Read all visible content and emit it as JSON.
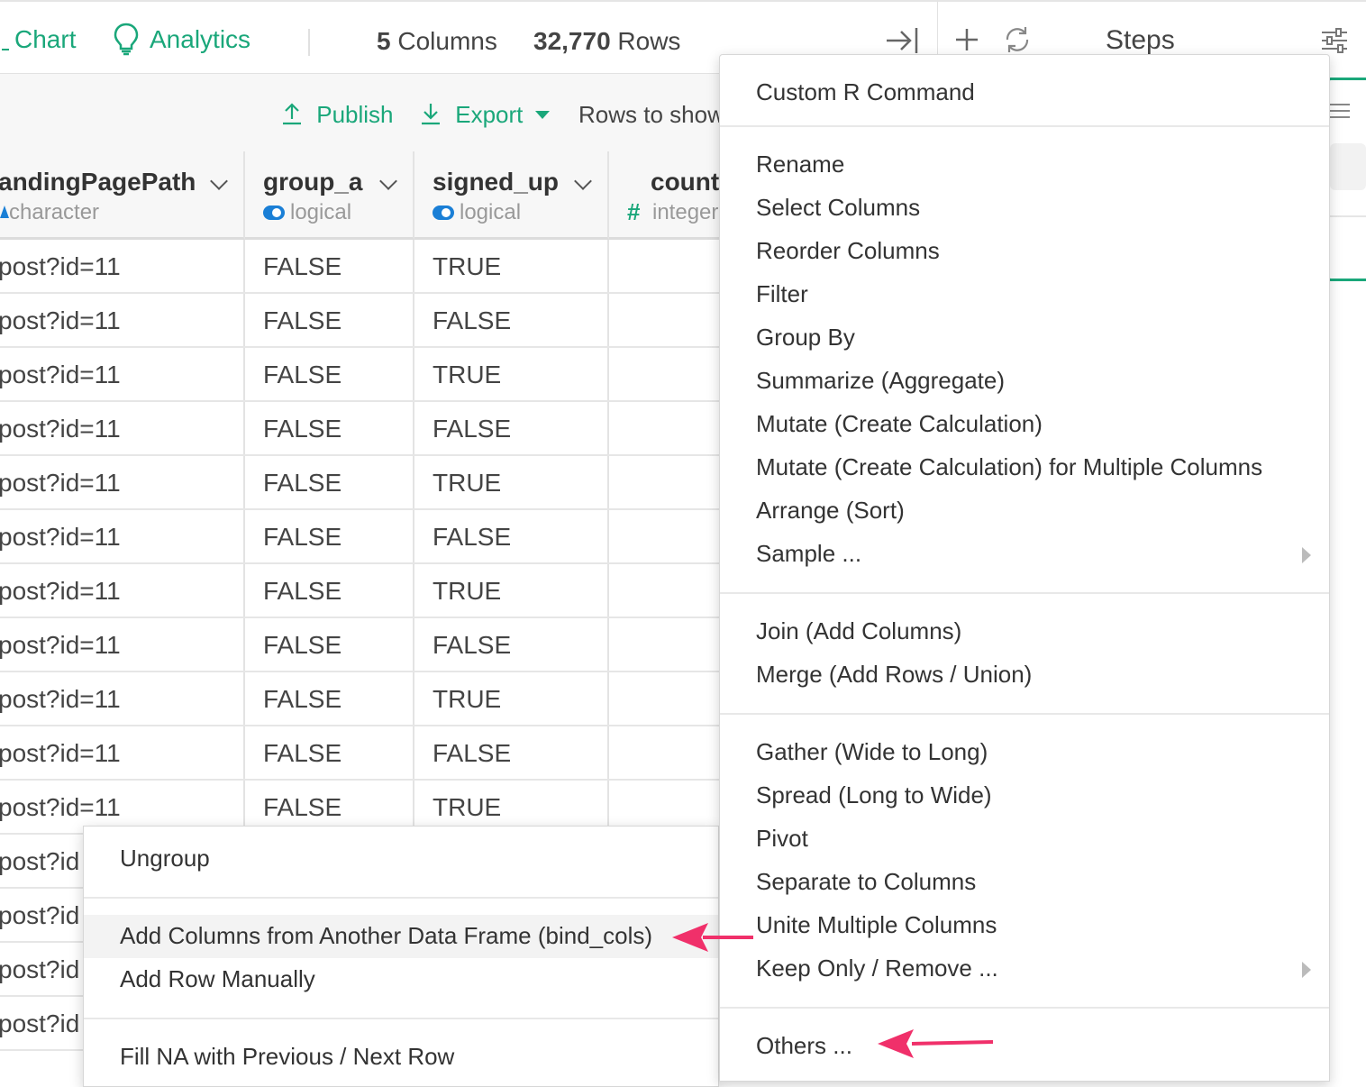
{
  "topbar": {
    "chart_label": "Chart",
    "analytics_label": "Analytics",
    "columns_count": "5",
    "columns_label": "Columns",
    "rows_count": "32,770",
    "rows_label": "Rows"
  },
  "steps_panel": {
    "title": "Steps"
  },
  "toolbar": {
    "publish_label": "Publish",
    "export_label": "Export",
    "rows_to_show_label": "Rows to show"
  },
  "table": {
    "columns": [
      {
        "name": "andingPagePath",
        "type": "character",
        "type_icon": "character-icon"
      },
      {
        "name": "group_a",
        "type": "logical",
        "type_icon": "toggle-icon"
      },
      {
        "name": "signed_up",
        "type": "logical",
        "type_icon": "toggle-icon"
      },
      {
        "name": "count",
        "type": "integer",
        "type_icon": "hash-icon"
      }
    ],
    "rows": [
      [
        "post?id=11",
        "FALSE",
        "TRUE",
        ""
      ],
      [
        "post?id=11",
        "FALSE",
        "FALSE",
        ""
      ],
      [
        "post?id=11",
        "FALSE",
        "TRUE",
        ""
      ],
      [
        "post?id=11",
        "FALSE",
        "FALSE",
        ""
      ],
      [
        "post?id=11",
        "FALSE",
        "TRUE",
        ""
      ],
      [
        "post?id=11",
        "FALSE",
        "FALSE",
        ""
      ],
      [
        "post?id=11",
        "FALSE",
        "TRUE",
        ""
      ],
      [
        "post?id=11",
        "FALSE",
        "FALSE",
        ""
      ],
      [
        "post?id=11",
        "FALSE",
        "TRUE",
        ""
      ],
      [
        "post?id=11",
        "FALSE",
        "FALSE",
        ""
      ],
      [
        "post?id=11",
        "FALSE",
        "TRUE",
        ""
      ],
      [
        "post?id",
        "",
        "",
        ""
      ],
      [
        "post?id",
        "",
        "",
        ""
      ],
      [
        "post?id",
        "",
        "",
        ""
      ],
      [
        "post?id",
        "",
        "",
        ""
      ]
    ]
  },
  "main_menu": {
    "items": [
      "Custom R Command",
      "Rename",
      "Select Columns",
      "Reorder Columns",
      "Filter",
      "Group By",
      "Summarize (Aggregate)",
      "Mutate (Create Calculation)",
      "Mutate (Create Calculation) for Multiple Columns",
      "Arrange (Sort)",
      "Sample ...",
      "Join (Add Columns)",
      "Merge (Add Rows / Union)",
      "Gather (Wide to Long)",
      "Spread (Long to Wide)",
      "Pivot",
      "Separate to Columns",
      "Unite Multiple Columns",
      "Keep Only / Remove ...",
      "Others ..."
    ]
  },
  "sub_menu": {
    "items": [
      "Ungroup",
      "Add Columns from Another Data Frame (bind_cols)",
      "Add Row Manually",
      "Fill NA with Previous / Next Row"
    ]
  },
  "colors": {
    "accent": "#1aa77a",
    "annotation_arrow": "#f0306a",
    "toggle_blue": "#1a7fd6"
  }
}
